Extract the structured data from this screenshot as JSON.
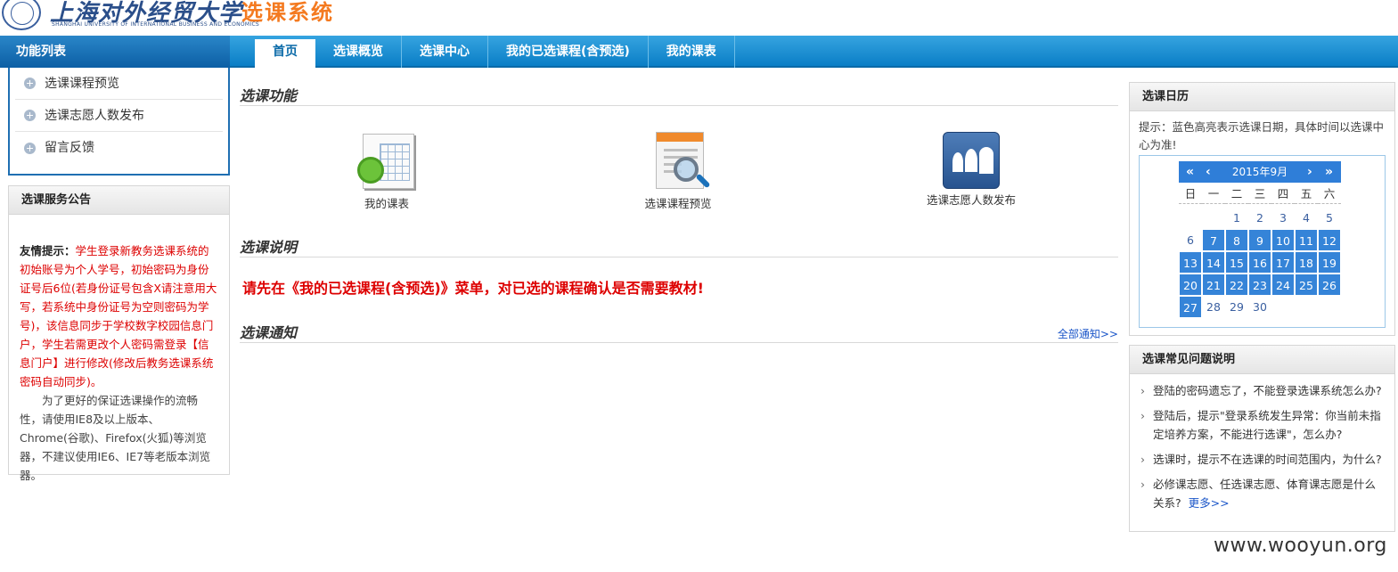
{
  "header": {
    "logo_cn": "上海对外经贸大学",
    "logo_en": "SHANGHAI UNIVERSITY OF INTERNATIONAL BUSINESS AND ECONOMICS",
    "system_title": "选课系统"
  },
  "nav": {
    "left_title": "功能列表",
    "tabs": [
      {
        "label": "首页"
      },
      {
        "label": "选课概览"
      },
      {
        "label": "选课中心"
      },
      {
        "label": "我的已选课程(含预选)"
      },
      {
        "label": "我的课表"
      }
    ]
  },
  "sidebar": {
    "items": [
      {
        "label": "选课课程预览"
      },
      {
        "label": "选课志愿人数发布"
      },
      {
        "label": "留言反馈"
      }
    ]
  },
  "announcement": {
    "title": "选课服务公告",
    "tip_label": "友情提示：",
    "tip_red": "学生登录新教务选课系统的初始账号为个人学号，初始密码为身份证号后6位(若身份证号包含X请注意用大写，若系统中身份证号为空则密码为学号)，该信息同步于学校数字校园信息门户，学生若需更改个人密码需登录【信息门户】进行修改(修改后教务选课系统密码自动同步)。",
    "tip_normal": "为了更好的保证选课操作的流畅性，请使用IE8及以上版本、Chrome(谷歌)、Firefox(火狐)等浏览器，不建议使用IE6、IE7等老版本浏览器。"
  },
  "main": {
    "section_functions": "选课功能",
    "functions": [
      {
        "label": "我的课表"
      },
      {
        "label": "选课课程预览"
      },
      {
        "label": "选课志愿人数发布"
      }
    ],
    "section_notes": "选课说明",
    "note_text": "请先在《我的已选课程(含预选)》菜单，对已选的课程确认是否需要教材!",
    "section_notices": "选课通知",
    "all_notices": "全部通知>>"
  },
  "calendar": {
    "title": "选课日历",
    "tip": "提示：蓝色高亮表示选课日期，具体时间以选课中心为准!",
    "month": "2015年9月",
    "prev_year": "«",
    "prev_month": "‹",
    "next_month": "›",
    "next_year": "»",
    "weekdays": [
      "日",
      "一",
      "二",
      "三",
      "四",
      "五",
      "六"
    ],
    "weeks": [
      [
        null,
        null,
        1,
        2,
        3,
        4,
        5
      ],
      [
        6,
        7,
        8,
        9,
        10,
        11,
        12
      ],
      [
        13,
        14,
        15,
        16,
        17,
        18,
        19
      ],
      [
        20,
        21,
        22,
        23,
        24,
        25,
        26
      ],
      [
        27,
        28,
        29,
        30,
        null,
        null,
        null
      ]
    ],
    "highlighted": [
      7,
      8,
      9,
      10,
      11,
      12,
      13,
      14,
      15,
      16,
      17,
      18,
      19,
      20,
      21,
      22,
      23,
      24,
      25,
      26,
      27
    ]
  },
  "faq": {
    "title": "选课常见问题说明",
    "items": [
      {
        "text": "登陆的密码遗忘了，不能登录选课系统怎么办?"
      },
      {
        "text": "登陆后，提示\"登录系统发生异常：你当前未指定培养方案，不能进行选课\"，怎么办?"
      },
      {
        "text": "选课时，提示不在选课的时间范围内，为什么?"
      },
      {
        "text": "必修课志愿、任选课志愿、体育课志愿是什么关系?"
      }
    ],
    "more": "更多>>"
  },
  "watermark": "www.wooyun.org",
  "colors": {
    "nav_blue": "#0a7ec6",
    "accent_orange": "#f47a20",
    "alert_red": "#dd0000",
    "calendar_highlight": "#3584d8",
    "link_blue": "#1a55c8"
  }
}
